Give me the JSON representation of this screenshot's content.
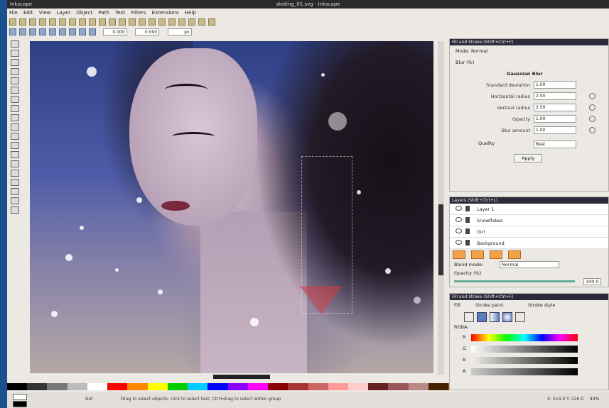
{
  "window": {
    "title": "skating_01.svg - Inkscape",
    "app_label": "Inkscape"
  },
  "menu": [
    "File",
    "Edit",
    "View",
    "Layer",
    "Object",
    "Path",
    "Text",
    "Filters",
    "Extensions",
    "Help"
  ],
  "toolbar": {
    "x_value": "0.000",
    "y_value": "0.000",
    "units": "px"
  },
  "canvas": {
    "description_hidden": true
  },
  "panels": {
    "blur": {
      "title": "Fill and Stroke (Shift+Ctrl+F)",
      "mode_label": "Mode: Normal",
      "blend_label": "Blur (%)",
      "section": "Gaussian Blur",
      "rows": [
        {
          "label": "Standard deviation",
          "value": "1.00"
        },
        {
          "label": "Horizontal radius",
          "value": "2.50"
        },
        {
          "label": "Vertical radius",
          "value": "2.50"
        },
        {
          "label": "Opacity",
          "value": "1.00"
        },
        {
          "label": "Blur amount",
          "value": "1.00"
        }
      ],
      "quality_label": "Quality",
      "quality_value": "Best",
      "apply_label": "Apply"
    },
    "layers": {
      "title": "Layers (Shift+Ctrl+L)",
      "items": [
        "Layer 1",
        "Snowflakes",
        "Girl",
        "Background"
      ],
      "blend_label": "Blend mode:",
      "blend_value": "Normal",
      "opacity_label": "Opacity (%)",
      "opacity_value": "100.0"
    },
    "fill": {
      "title": "Fill and Stroke (Shift+Ctrl+F)",
      "tabs": [
        "Fill",
        "Stroke paint",
        "Stroke style"
      ],
      "rgba_label": "RGBA:",
      "channels": [
        "R",
        "G",
        "B",
        "A"
      ]
    }
  },
  "status": {
    "message": "Drag to select objects; click to select text; Ctrl+drag to select within group",
    "coord": "X: 514.0  Y: 226.0",
    "zoom": "43%",
    "layer": "Girl"
  },
  "colors": {
    "accent": "#2a2a3a",
    "desktop": "#1d4f8f",
    "panel_bg": "#ece9e4"
  }
}
